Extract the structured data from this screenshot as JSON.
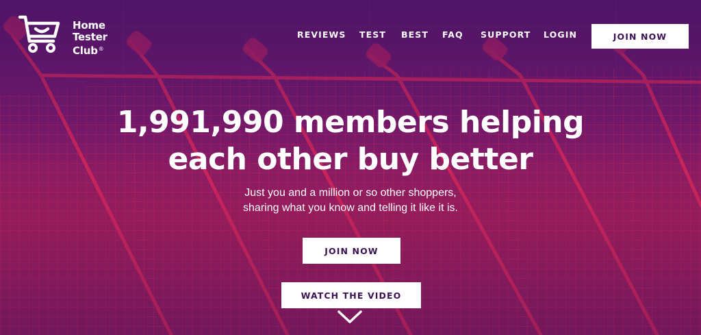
{
  "brand": {
    "line1": "Home",
    "line2": "Tester",
    "line3": "Club",
    "registered": "®",
    "logo_icon": "shopping-cart-smile-icon"
  },
  "nav": {
    "items": [
      {
        "label": "REVIEWS"
      },
      {
        "label": "TEST"
      },
      {
        "label": "BEST"
      },
      {
        "label": "FAQ"
      },
      {
        "label": "SUPPORT"
      },
      {
        "label": "LOGIN"
      }
    ],
    "join_label": "JOIN NOW"
  },
  "hero": {
    "headline_line1": "1,991,990 members helping",
    "headline_line2": "each other buy better",
    "sub_line1": "Just you and a million or so other shoppers,",
    "sub_line2": "sharing what you know and telling it like it is.",
    "join_label": "JOIN NOW",
    "video_label": "WATCH THE VIDEO",
    "scroll_icon": "chevron-down-icon"
  },
  "colors": {
    "overlay_purple": "#55166b",
    "overlay_magenta": "#a61f5a",
    "cart_red": "#e0285a",
    "button_text": "#3b1154",
    "white": "#ffffff"
  }
}
